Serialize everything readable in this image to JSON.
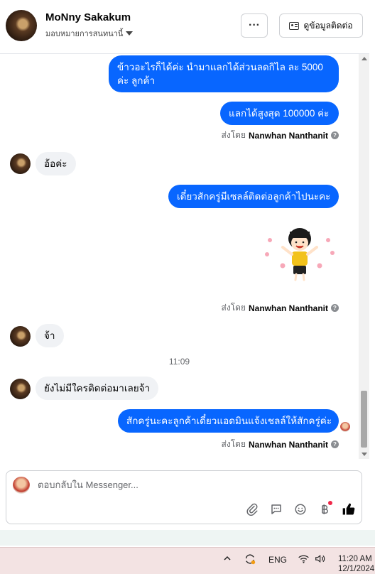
{
  "header": {
    "contact_name": "MoNny Sakakum",
    "assign_label": "มอบหมายการสนทนานี้",
    "more_label": "···",
    "view_contact_label": "ดูข้อมูลติดต่อ"
  },
  "messages": {
    "m1": "ข้าวอะไรก็ได้ค่ะ นำมาแลกได้ส่วนลดกิไล ละ 5000 ค่ะ ลูกค้า",
    "m2": "แลกได้สูงสุด 100000 ค่ะ",
    "m3": "อ้อค่ะ",
    "m4": "เดี๋ยวสักครู่มีเซลล์ติดต่อลูกค้าไปนะคะ",
    "m5": "จ้า",
    "m6": "ยังไม่มีใครติดต่อมาเลยจ้า",
    "m7": "สักครู่นะคะลูกค้าเดี๋ยวแอดมินแจ้งเชลล์ให้สักครู่ค่ะ"
  },
  "sent_by": {
    "prefix": "ส่งโดย",
    "name": "Nanwhan Nanthanit"
  },
  "time_divider": "11:09",
  "reply": {
    "placeholder": "ตอบกลับใน Messenger..."
  },
  "taskbar": {
    "language": "ENG",
    "time": "11:20 AM",
    "date": "12/1/2024"
  },
  "icons": {
    "attach": "paperclip-icon",
    "quick_reply": "chat-bubble-icon",
    "emoji": "smiley-icon",
    "payment": "baht-icon",
    "like": "thumbs-up-icon"
  },
  "colors": {
    "outgoing_bubble": "#0866ff",
    "incoming_bubble": "#f0f2f5",
    "like_icon": "#050505"
  }
}
